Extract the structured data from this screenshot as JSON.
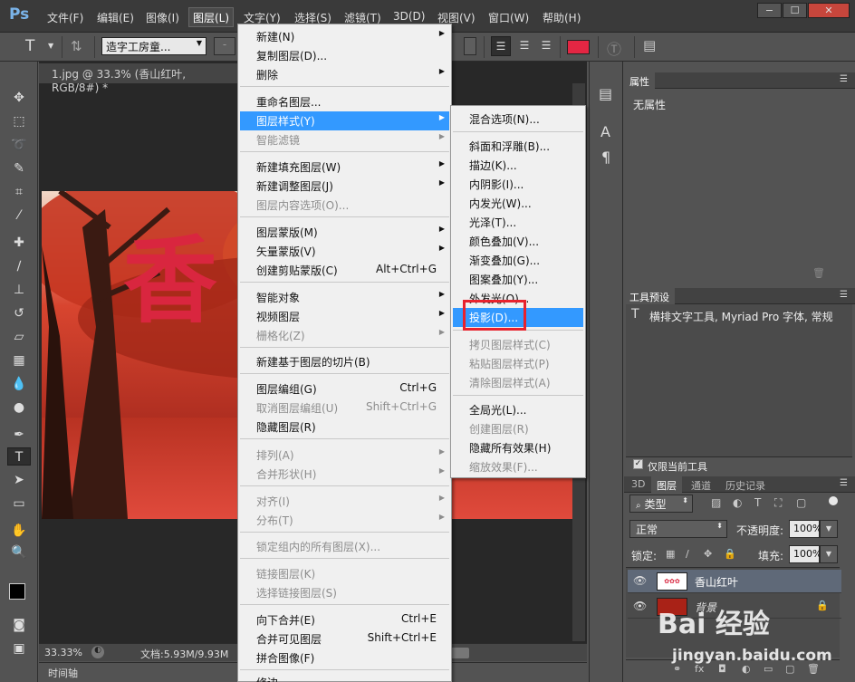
{
  "app": {
    "logo": "Ps"
  },
  "menubar": {
    "items": [
      "文件(F)",
      "编辑(E)",
      "图像(I)",
      "图层(L)",
      "文字(Y)",
      "选择(S)",
      "滤镜(T)",
      "3D(D)",
      "视图(V)",
      "窗口(W)",
      "帮助(H)"
    ],
    "window_controls": {
      "minimize": "−",
      "restore": "☐",
      "close": "✕"
    }
  },
  "options_bar": {
    "tool_glyph": "T",
    "font_family": "造字工房童...",
    "font_style_placeholder": "-",
    "text_color": "#e32643"
  },
  "document": {
    "tab_title": "1.jpg @ 33.3% (香山红叶, RGB/8#) *",
    "zoom": "33.33%",
    "doc_size": "文档:5.93M/9.93M",
    "timeline_label": "时间轴",
    "canvas_text": "香"
  },
  "layer_menu": {
    "items": [
      {
        "label": "新建(N)",
        "submenu": true
      },
      {
        "label": "复制图层(D)...",
        "submenu": false
      },
      {
        "label": "删除",
        "submenu": true
      },
      {
        "label": "重命名图层...",
        "submenu": false
      },
      {
        "label": "图层样式(Y)",
        "submenu": true,
        "highlighted": true
      },
      {
        "label": "智能滤镜",
        "submenu": true,
        "disabled": true
      },
      {
        "label": "新建填充图层(W)",
        "submenu": true
      },
      {
        "label": "新建调整图层(J)",
        "submenu": true
      },
      {
        "label": "图层内容选项(O)...",
        "submenu": false,
        "disabled": true
      },
      {
        "label": "图层蒙版(M)",
        "submenu": true
      },
      {
        "label": "矢量蒙版(V)",
        "submenu": true
      },
      {
        "label": "创建剪贴蒙版(C)",
        "shortcut": "Alt+Ctrl+G"
      },
      {
        "label": "智能对象",
        "submenu": true
      },
      {
        "label": "视频图层",
        "submenu": true
      },
      {
        "label": "栅格化(Z)",
        "submenu": true,
        "disabled": true
      },
      {
        "label": "新建基于图层的切片(B)"
      },
      {
        "label": "图层编组(G)",
        "shortcut": "Ctrl+G"
      },
      {
        "label": "取消图层编组(U)",
        "shortcut": "Shift+Ctrl+G",
        "disabled": true
      },
      {
        "label": "隐藏图层(R)"
      },
      {
        "label": "排列(A)",
        "submenu": true,
        "disabled": true
      },
      {
        "label": "合并形状(H)",
        "submenu": true,
        "disabled": true
      },
      {
        "label": "对齐(I)",
        "submenu": true,
        "disabled": true
      },
      {
        "label": "分布(T)",
        "submenu": true,
        "disabled": true
      },
      {
        "label": "锁定组内的所有图层(X)...",
        "disabled": true
      },
      {
        "label": "链接图层(K)",
        "disabled": true
      },
      {
        "label": "选择链接图层(S)",
        "disabled": true
      },
      {
        "label": "向下合并(E)",
        "shortcut": "Ctrl+E"
      },
      {
        "label": "合并可见图层",
        "shortcut": "Shift+Ctrl+E"
      },
      {
        "label": "拼合图像(F)"
      },
      {
        "label": "修边",
        "submenu": true
      }
    ]
  },
  "style_submenu": {
    "items": [
      {
        "label": "混合选项(N)..."
      },
      {
        "label": "斜面和浮雕(B)..."
      },
      {
        "label": "描边(K)..."
      },
      {
        "label": "内阴影(I)..."
      },
      {
        "label": "内发光(W)..."
      },
      {
        "label": "光泽(T)..."
      },
      {
        "label": "颜色叠加(V)..."
      },
      {
        "label": "渐变叠加(G)..."
      },
      {
        "label": "图案叠加(Y)..."
      },
      {
        "label": "外发光(O)..."
      },
      {
        "label": "投影(D)...",
        "highlighted": true
      },
      {
        "label": "拷贝图层样式(C)",
        "disabled": true
      },
      {
        "label": "粘贴图层样式(P)",
        "disabled": true
      },
      {
        "label": "清除图层样式(A)",
        "disabled": true
      },
      {
        "label": "全局光(L)..."
      },
      {
        "label": "创建图层(R)",
        "disabled": true
      },
      {
        "label": "隐藏所有效果(H)"
      },
      {
        "label": "缩放效果(F)...",
        "disabled": true
      }
    ]
  },
  "properties_panel": {
    "title": "属性",
    "content": "无属性"
  },
  "tool_presets_panel": {
    "title": "工具预设",
    "entry": "横排文字工具, Myriad Pro 字体, 常规",
    "current_tool_only": "仅限当前工具"
  },
  "layers_panel": {
    "tabs": [
      "3D",
      "图层",
      "通道",
      "历史记录"
    ],
    "filter_kind": "类型",
    "blend_mode": "正常",
    "opacity_label": "不透明度:",
    "opacity_value": "100%",
    "lock_label": "锁定:",
    "fill_label": "填充:",
    "fill_value": "100%",
    "layers": [
      {
        "name": "香山红叶",
        "selected": true
      },
      {
        "name": "背景",
        "locked": true
      }
    ]
  },
  "watermark": {
    "brand": "Bai 经验",
    "url": "jingyan.baidu.com"
  }
}
